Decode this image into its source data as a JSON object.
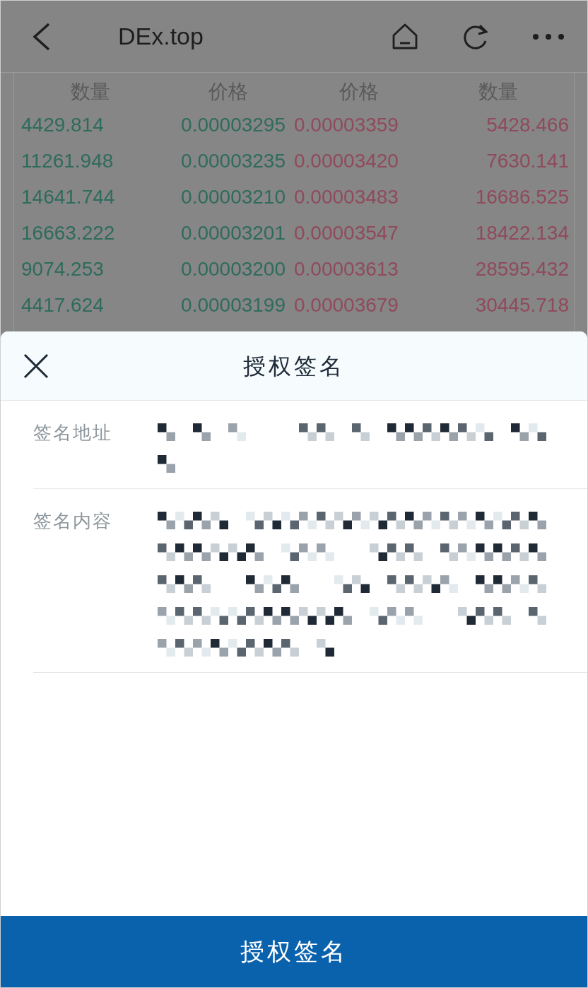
{
  "top_bar": {
    "title": "DEx.top"
  },
  "order_book": {
    "columns": [
      "数量",
      "价格",
      "价格",
      "数量"
    ],
    "rows": [
      {
        "bid_qty": "4429.814",
        "bid_price": "0.00003295",
        "ask_price": "0.00003359",
        "ask_qty": "5428.466"
      },
      {
        "bid_qty": "11261.948",
        "bid_price": "0.00003235",
        "ask_price": "0.00003420",
        "ask_qty": "7630.141"
      },
      {
        "bid_qty": "14641.744",
        "bid_price": "0.00003210",
        "ask_price": "0.00003483",
        "ask_qty": "16686.525"
      },
      {
        "bid_qty": "16663.222",
        "bid_price": "0.00003201",
        "ask_price": "0.00003547",
        "ask_qty": "18422.134"
      },
      {
        "bid_qty": "9074.253",
        "bid_price": "0.00003200",
        "ask_price": "0.00003613",
        "ask_qty": "28595.432"
      },
      {
        "bid_qty": "4417.624",
        "bid_price": "0.00003199",
        "ask_price": "0.00003679",
        "ask_qty": "30445.718"
      }
    ]
  },
  "sheet": {
    "title": "授权签名",
    "fields": [
      {
        "label": "签名地址",
        "redacted": true
      },
      {
        "label": "签名内容",
        "redacted": true
      }
    ],
    "button": "授权签名"
  }
}
